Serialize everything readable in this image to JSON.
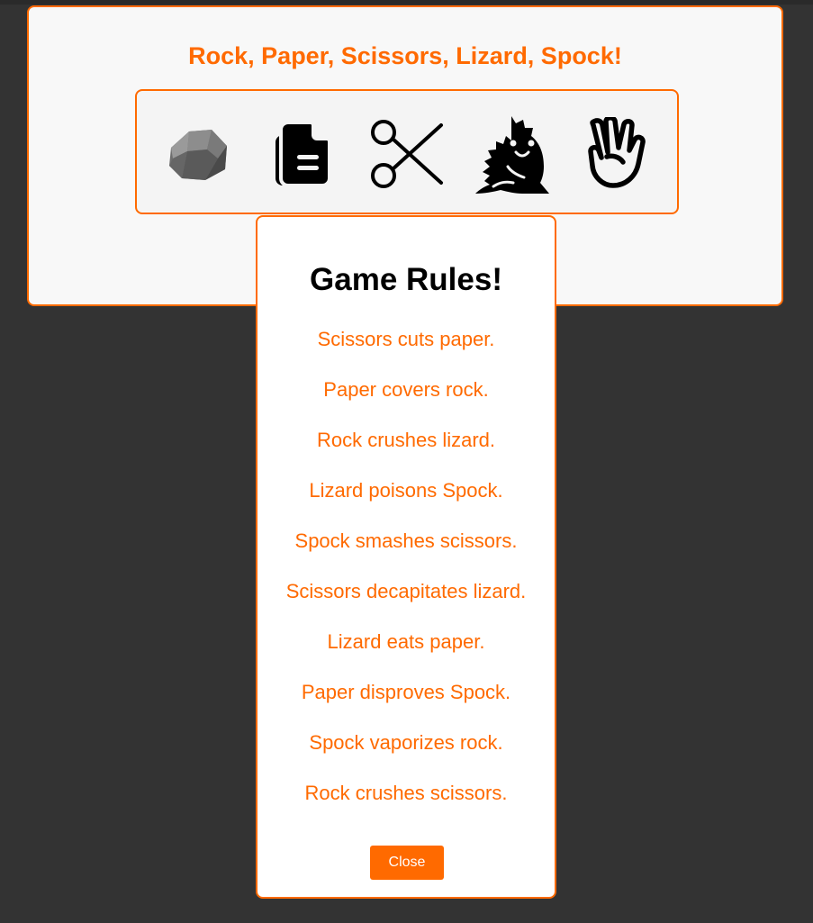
{
  "game": {
    "title": "Rock, Paper, Scissors, Lizard, Spock!",
    "choices": [
      {
        "name": "Rock",
        "icon": "rock-icon"
      },
      {
        "name": "Paper",
        "icon": "paper-icon"
      },
      {
        "name": "Scissors",
        "icon": "scissors-icon"
      },
      {
        "name": "Lizard",
        "icon": "lizard-icon"
      },
      {
        "name": "Spock",
        "icon": "spock-hand-icon"
      }
    ]
  },
  "modal": {
    "title": "Game Rules!",
    "rules": [
      "Scissors cuts paper.",
      "Paper covers rock.",
      "Rock crushes lizard.",
      "Lizard poisons Spock.",
      "Spock smashes scissors.",
      "Scissors decapitates lizard.",
      "Lizard eats paper.",
      "Paper disproves Spock.",
      "Spock vaporizes rock.",
      "Rock crushes scissors."
    ],
    "close_label": "Close"
  },
  "colors": {
    "accent": "#ff6a00",
    "background": "#333333",
    "card": "#f8f8f8",
    "modal": "#ffffff"
  }
}
